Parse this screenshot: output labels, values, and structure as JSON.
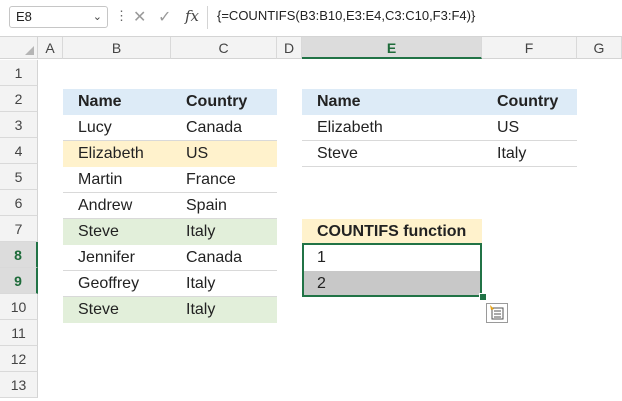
{
  "formula_bar": {
    "name_box": "E8",
    "formula": "{=COUNTIFS(B3:B10,E3:E4,C3:C10,F3:F4)}",
    "fx_label": "fx"
  },
  "columns": [
    "A",
    "B",
    "C",
    "D",
    "E",
    "F",
    "G"
  ],
  "rows": [
    "1",
    "2",
    "3",
    "4",
    "5",
    "6",
    "7",
    "8",
    "9",
    "10",
    "11",
    "12",
    "13"
  ],
  "table1": {
    "headers": [
      "Name",
      "Country"
    ],
    "rows": [
      [
        "Lucy",
        "Canada"
      ],
      [
        "Elizabeth",
        "US"
      ],
      [
        "Martin",
        "France"
      ],
      [
        "Andrew",
        "Spain"
      ],
      [
        "Steve",
        "Italy"
      ],
      [
        "Jennifer",
        "Canada"
      ],
      [
        "Geoffrey",
        "Italy"
      ],
      [
        "Steve",
        "Italy"
      ]
    ]
  },
  "criteria": {
    "headers": [
      "Name",
      "Country"
    ],
    "rows": [
      [
        "Elizabeth",
        "US"
      ],
      [
        "Steve",
        "Italy"
      ]
    ]
  },
  "result": {
    "header": "COUNTIFS function",
    "values": [
      "1",
      "2"
    ]
  },
  "colors": {
    "header_fill": "#ddebf7",
    "highlight_yellow": "#fff2cc",
    "highlight_green": "#e2efda",
    "selection": "#217346"
  }
}
